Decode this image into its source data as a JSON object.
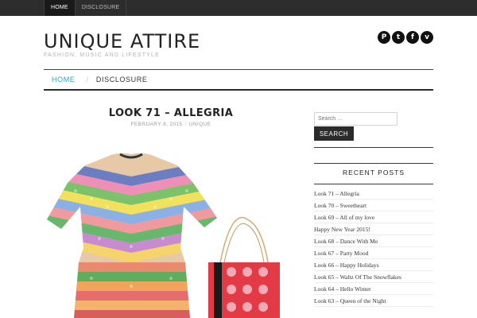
{
  "topnav": {
    "items": [
      {
        "label": "HOME",
        "active": true
      },
      {
        "label": "DISCLOSURE",
        "active": false
      }
    ]
  },
  "site": {
    "title": "UNIQUE ATTIRE",
    "description": "FASHION, MUSIC AND LIFESTYLE"
  },
  "social": [
    {
      "icon": "pinterest-icon",
      "glyph": "P"
    },
    {
      "icon": "twitter-icon",
      "glyph": "t"
    },
    {
      "icon": "facebook-icon",
      "glyph": "f"
    },
    {
      "icon": "vimeo-icon",
      "glyph": "v"
    }
  ],
  "mainnav": {
    "items": [
      {
        "label": "HOME",
        "active": true
      },
      {
        "label": "DISCLOSURE",
        "active": false
      }
    ],
    "separator": "/"
  },
  "post": {
    "title": "LOOK 71 – ALLEGRIA",
    "date": "FEBRUARY 8, 2015",
    "separator": "/",
    "category": "UNIQUE"
  },
  "sidebar": {
    "search": {
      "placeholder": "Search …",
      "button_label": "SEARCH"
    },
    "recent_posts": {
      "title": "RECENT POSTS",
      "items": [
        "Look 71 – Allegria",
        "Look 70 – Sweetheart",
        "Look 69 – All of my love",
        "Happy New Year 2015!",
        "Look 68 – Dance With Me",
        "Look 67 – Party Mood",
        "Look 66 – Happy Holidays",
        "Look 65 – Waltz Of The Snowflakes",
        "Look 64 – Hello Winter",
        "Look 63 – Queen of the Night"
      ]
    }
  },
  "colors": {
    "accent": "#34a3c3",
    "topbar": "#2d2d2d"
  }
}
